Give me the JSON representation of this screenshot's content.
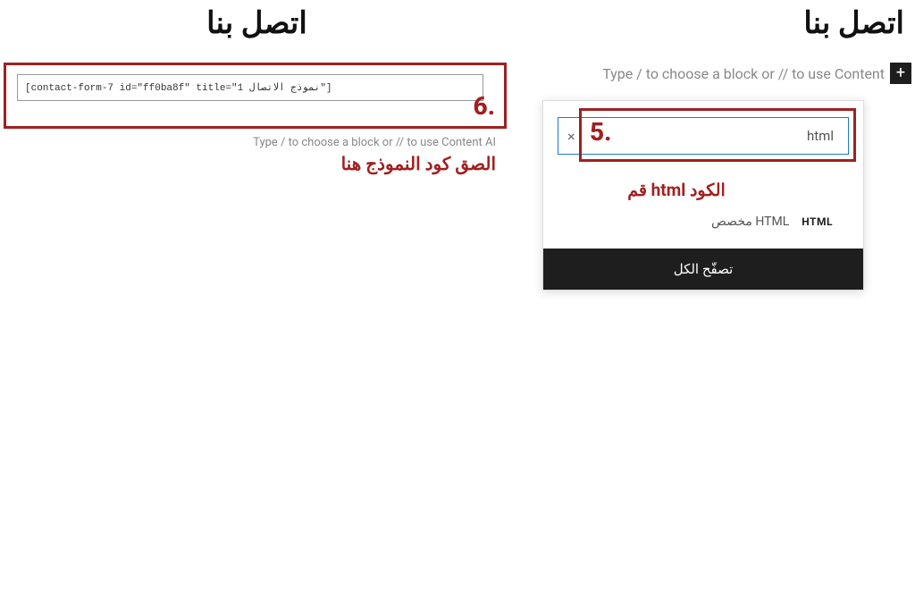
{
  "heading": "اتصل بنا",
  "left": {
    "code_value": "[contact-form-7 id=\"ff0ba8f\" title=\"نموذج الاتصال 1\"]",
    "step": "6.",
    "hint": "Type / to choose a block or // to use Content AI",
    "annotation": "الصق كود النموذج هنا"
  },
  "right": {
    "hint": "Type / to choose a block or // to use Content",
    "plus": "+",
    "popup": {
      "search_value": "html",
      "close": "×",
      "step": "5.",
      "annotation": "قم html الكود",
      "option_html_icon": "HTML",
      "option_label": "HTML مخصص",
      "browse_all": "تصفّح الكل"
    }
  }
}
